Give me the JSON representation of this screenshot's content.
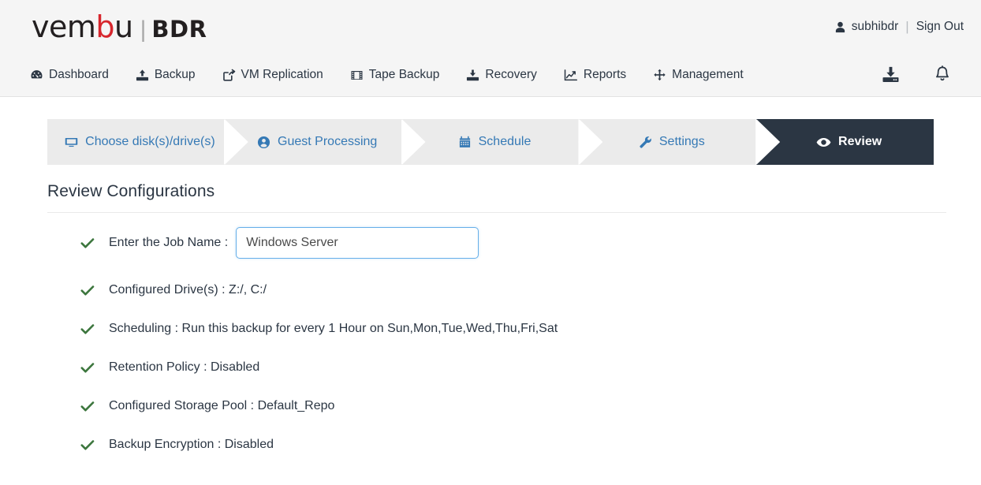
{
  "brand": {
    "name_part1": "vem",
    "name_part2": "b",
    "name_part3": "u",
    "separator": "|",
    "product": "BDR",
    "accent_color": "#d7262d"
  },
  "account": {
    "user_icon": "user-icon",
    "username": "subhibdr",
    "separator": "|",
    "sign_out_label": "Sign Out"
  },
  "nav": {
    "items": [
      {
        "label": "Dashboard",
        "icon": "tachometer-icon"
      },
      {
        "label": "Backup",
        "icon": "upload-icon"
      },
      {
        "label": "VM Replication",
        "icon": "share-square-icon"
      },
      {
        "label": "Tape Backup",
        "icon": "film-icon"
      },
      {
        "label": "Recovery",
        "icon": "download-icon"
      },
      {
        "label": "Reports",
        "icon": "line-chart-icon"
      },
      {
        "label": "Management",
        "icon": "arrows-move-icon"
      }
    ],
    "right_icons": [
      {
        "name": "download-tray-icon"
      },
      {
        "name": "bell-icon"
      }
    ]
  },
  "wizard": {
    "active_step": "Review",
    "active_bg": "#2b3643",
    "inactive_bg": "#ebebeb",
    "link_color": "#3579b5",
    "steps": [
      {
        "label": "Choose disk(s)/drive(s)",
        "icon": "desktop-icon",
        "active": false
      },
      {
        "label": "Guest Processing",
        "icon": "user-circle-icon",
        "active": false
      },
      {
        "label": "Schedule",
        "icon": "calendar-icon",
        "active": false
      },
      {
        "label": "Settings",
        "icon": "wrench-icon",
        "active": false
      },
      {
        "label": "Review",
        "icon": "eye-icon",
        "active": true
      }
    ]
  },
  "main": {
    "title": "Review Configurations",
    "check_color": "#3c763d",
    "job_name": {
      "check_icon": "check-icon",
      "label": "Enter the Job Name :",
      "value": "Windows Server ",
      "placeholder": "Enter the Job Name"
    },
    "rows": [
      {
        "check_icon": "check-icon",
        "text": "Configured Drive(s) : Z:/, C:/"
      },
      {
        "check_icon": "check-icon",
        "text": "Scheduling : Run this backup for every 1 Hour on Sun,Mon,Tue,Wed,Thu,Fri,Sat"
      },
      {
        "check_icon": "check-icon",
        "text": "Retention Policy : Disabled"
      },
      {
        "check_icon": "check-icon",
        "text": "Configured Storage Pool : Default_Repo"
      },
      {
        "check_icon": "check-icon",
        "text": "Backup Encryption : Disabled"
      }
    ]
  }
}
